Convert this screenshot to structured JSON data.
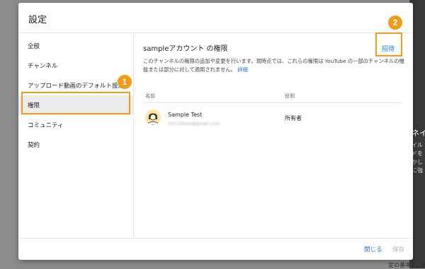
{
  "dialog": {
    "title": "設定"
  },
  "sidebar": {
    "items": [
      {
        "label": "全般"
      },
      {
        "label": "チャンネル"
      },
      {
        "label": "アップロード動画のデフォルト設定"
      },
      {
        "label": "権限"
      },
      {
        "label": "コミュニティ"
      },
      {
        "label": "契約"
      }
    ],
    "active_index": 3
  },
  "content": {
    "title": "sampleアカウント の権限",
    "invite_label": "招待",
    "description": "このチャンネルの権限の追加や変更を行います。現時点では、これらの権限は YouTube の一部のチャンネルの機能または部分に対して適用されません。",
    "more_link": "詳細",
    "columns": {
      "name": "名前",
      "role": "役割"
    },
    "users": [
      {
        "name": "Sample Test",
        "email": "20120test@gmail.com",
        "role": "所有者",
        "avatar": "person-icon"
      }
    ]
  },
  "footer": {
    "close_label": "閉じる",
    "save_label": "保存"
  },
  "annotations": {
    "marker_1": "1",
    "marker_2": "2",
    "color": "#f39a18"
  },
  "background": {
    "right_snippets": [
      "ネイ",
      "イル",
      "ドを",
      "かし",
      "に強"
    ],
    "bottom_snippets": [
      "定の基本をご確認く"
    ]
  }
}
